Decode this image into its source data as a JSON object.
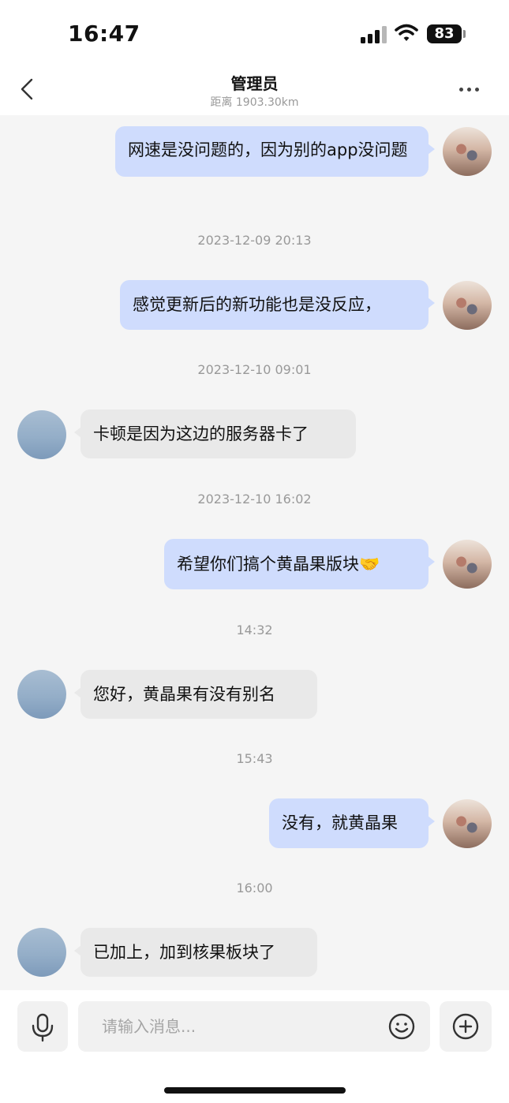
{
  "status_bar": {
    "time": "16:47",
    "battery": "83"
  },
  "header": {
    "title": "管理员",
    "subtitle": "距离 1903.30km"
  },
  "messages": [
    {
      "sender": "me",
      "text": "网速是没问题的，因为别的app没问题"
    },
    {
      "timestamp": "2023-12-09 20:13"
    },
    {
      "sender": "me",
      "text": "感觉更新后的新功能也是没反应，"
    },
    {
      "timestamp": "2023-12-10 09:01"
    },
    {
      "sender": "admin",
      "text": "卡顿是因为这边的服务器卡了"
    },
    {
      "timestamp": "2023-12-10 16:02"
    },
    {
      "sender": "me",
      "text": "希望你们搞个黄晶果版块🤝"
    },
    {
      "timestamp": "14:32"
    },
    {
      "sender": "admin",
      "text": "您好，黄晶果有没有别名"
    },
    {
      "timestamp": "15:43"
    },
    {
      "sender": "me",
      "text": "没有，就黄晶果"
    },
    {
      "timestamp": "16:00"
    },
    {
      "sender": "admin",
      "text": "已加上，加到核果板块了"
    }
  ],
  "input": {
    "placeholder": "请输入消息..."
  },
  "icons": {
    "back": "chevron-left-icon",
    "more": "more-horizontal-icon",
    "voice": "microphone-icon",
    "emoji": "smiley-icon",
    "add": "plus-circle-icon"
  },
  "colors": {
    "my_bubble": "#cfdcfd",
    "other_bubble": "#e9e9e9",
    "background": "#f5f5f5"
  }
}
